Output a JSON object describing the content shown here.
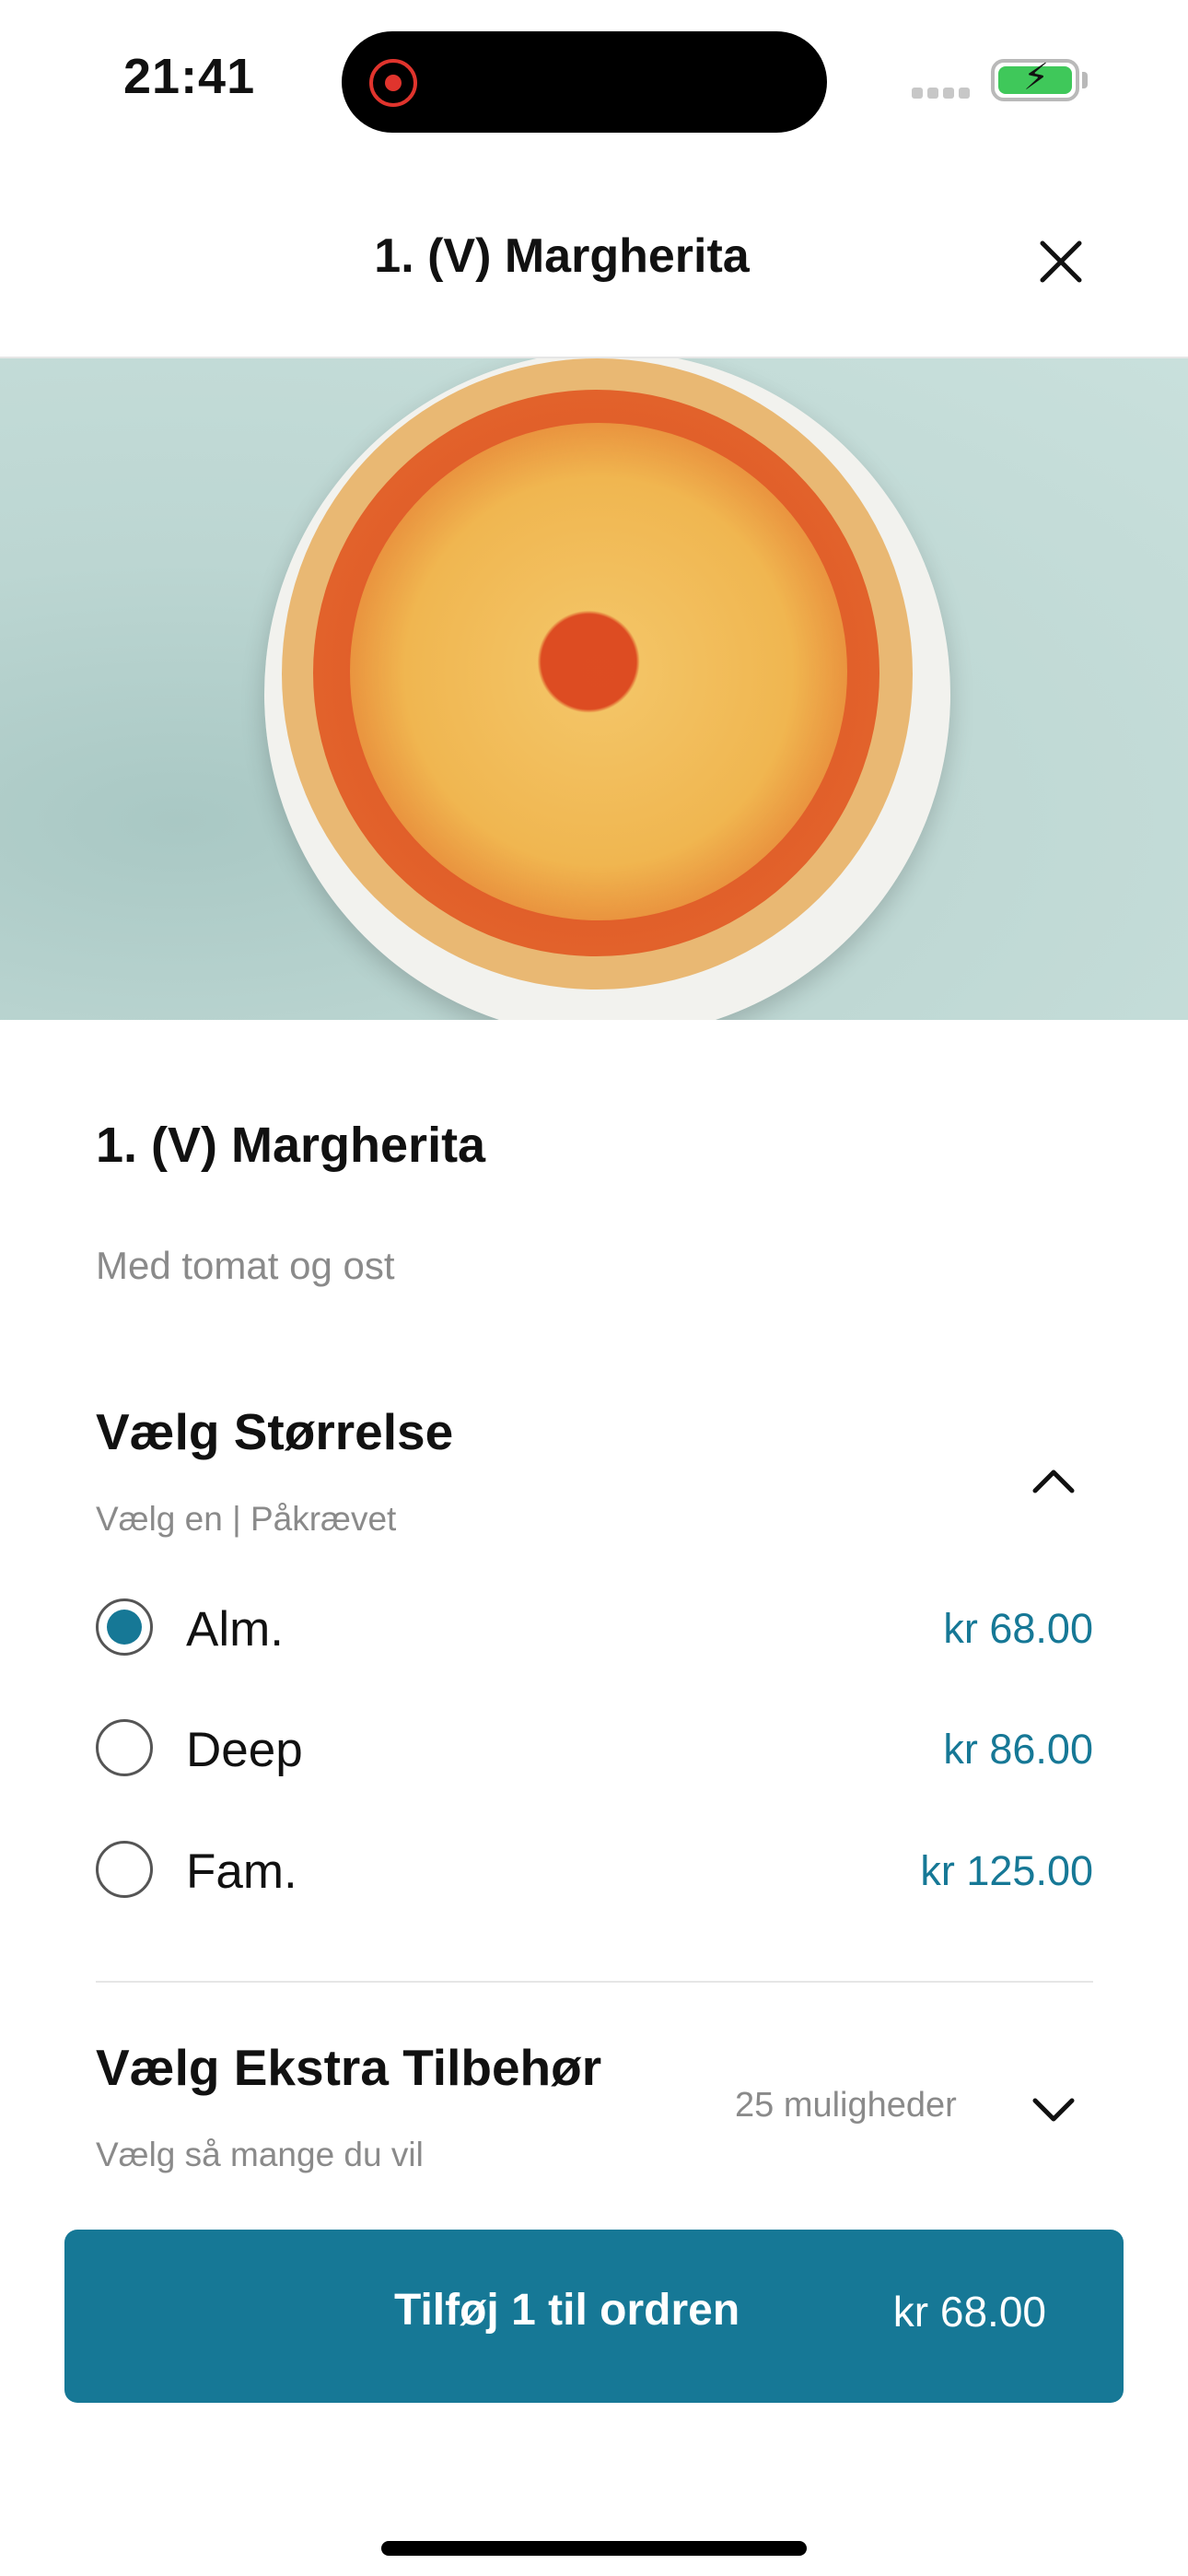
{
  "status_bar": {
    "time": "21:41",
    "battery_color": "#3fc85a",
    "record_color": "#e0342d"
  },
  "header": {
    "title": "1. (V) Margherita",
    "close_icon": "close-icon"
  },
  "product": {
    "title": "1. (V) Margherita",
    "description": "Med tomat og ost"
  },
  "size_group": {
    "title": "Vælg Størrelse",
    "subtitle": "Vælg en  |  Påkrævet",
    "expanded": true,
    "options": [
      {
        "label": "Alm.",
        "price": "kr 68.00",
        "selected": true
      },
      {
        "label": "Deep",
        "price": "kr 86.00",
        "selected": false
      },
      {
        "label": "Fam.",
        "price": "kr 125.00",
        "selected": false
      }
    ]
  },
  "extras_group": {
    "title": "Vælg Ekstra Tilbehør",
    "subtitle": "Vælg så mange du vil",
    "count": "25 muligheder",
    "expanded": false
  },
  "add_button": {
    "label": "Tilføj 1 til ordren",
    "price": "kr 68.00"
  },
  "colors": {
    "accent": "#167896"
  }
}
